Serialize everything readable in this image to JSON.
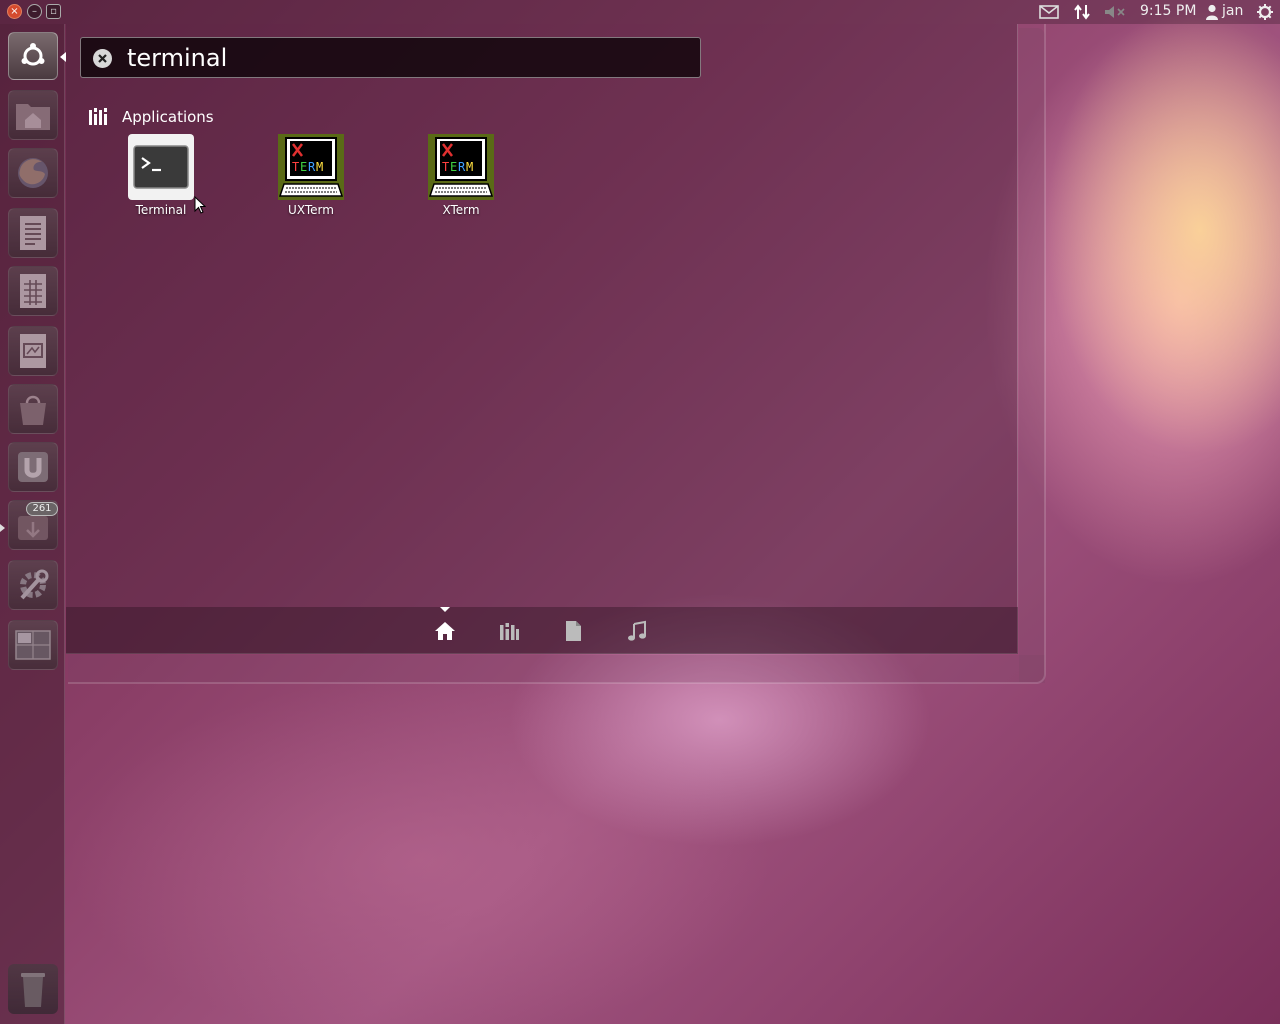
{
  "top_panel": {
    "window_controls": [
      "close",
      "minimize",
      "maximize"
    ],
    "indicators": [
      "mail-icon",
      "network-icon",
      "volume-muted-icon"
    ],
    "clock": "9:15 PM",
    "user": "jan",
    "session_icon": "gear-power-icon"
  },
  "launcher": {
    "home_button": "ubuntu-logo-icon",
    "items": [
      {
        "name": "home-folder",
        "icon": "folder-home-icon"
      },
      {
        "name": "firefox",
        "icon": "firefox-icon"
      },
      {
        "name": "writer",
        "icon": "document-icon"
      },
      {
        "name": "calc",
        "icon": "spreadsheet-icon"
      },
      {
        "name": "impress",
        "icon": "presentation-icon"
      },
      {
        "name": "software-center",
        "icon": "shopping-bag-icon"
      },
      {
        "name": "ubuntu-one",
        "icon": "ubuntu-one-icon"
      },
      {
        "name": "update-manager",
        "icon": "update-icon",
        "badge": "261"
      },
      {
        "name": "system-settings",
        "icon": "wrench-gear-icon"
      },
      {
        "name": "workspace-switcher",
        "icon": "workspaces-icon"
      }
    ],
    "trash_icon": "trash-icon"
  },
  "dash": {
    "search": {
      "value": "terminal",
      "placeholder": ""
    },
    "category": "Applications",
    "apps": [
      {
        "label": "Terminal",
        "icon": "terminal-icon"
      },
      {
        "label": "UXTerm",
        "icon": "xterm-icon"
      },
      {
        "label": "XTerm",
        "icon": "xterm-icon"
      }
    ],
    "lenses": [
      "home-icon",
      "applications-icon",
      "files-icon",
      "music-icon"
    ],
    "active_lens": "home-icon"
  },
  "colors": {
    "wallpaper": "#8a3e66",
    "search_bg": "#0f050a",
    "text": "#ffffff"
  }
}
